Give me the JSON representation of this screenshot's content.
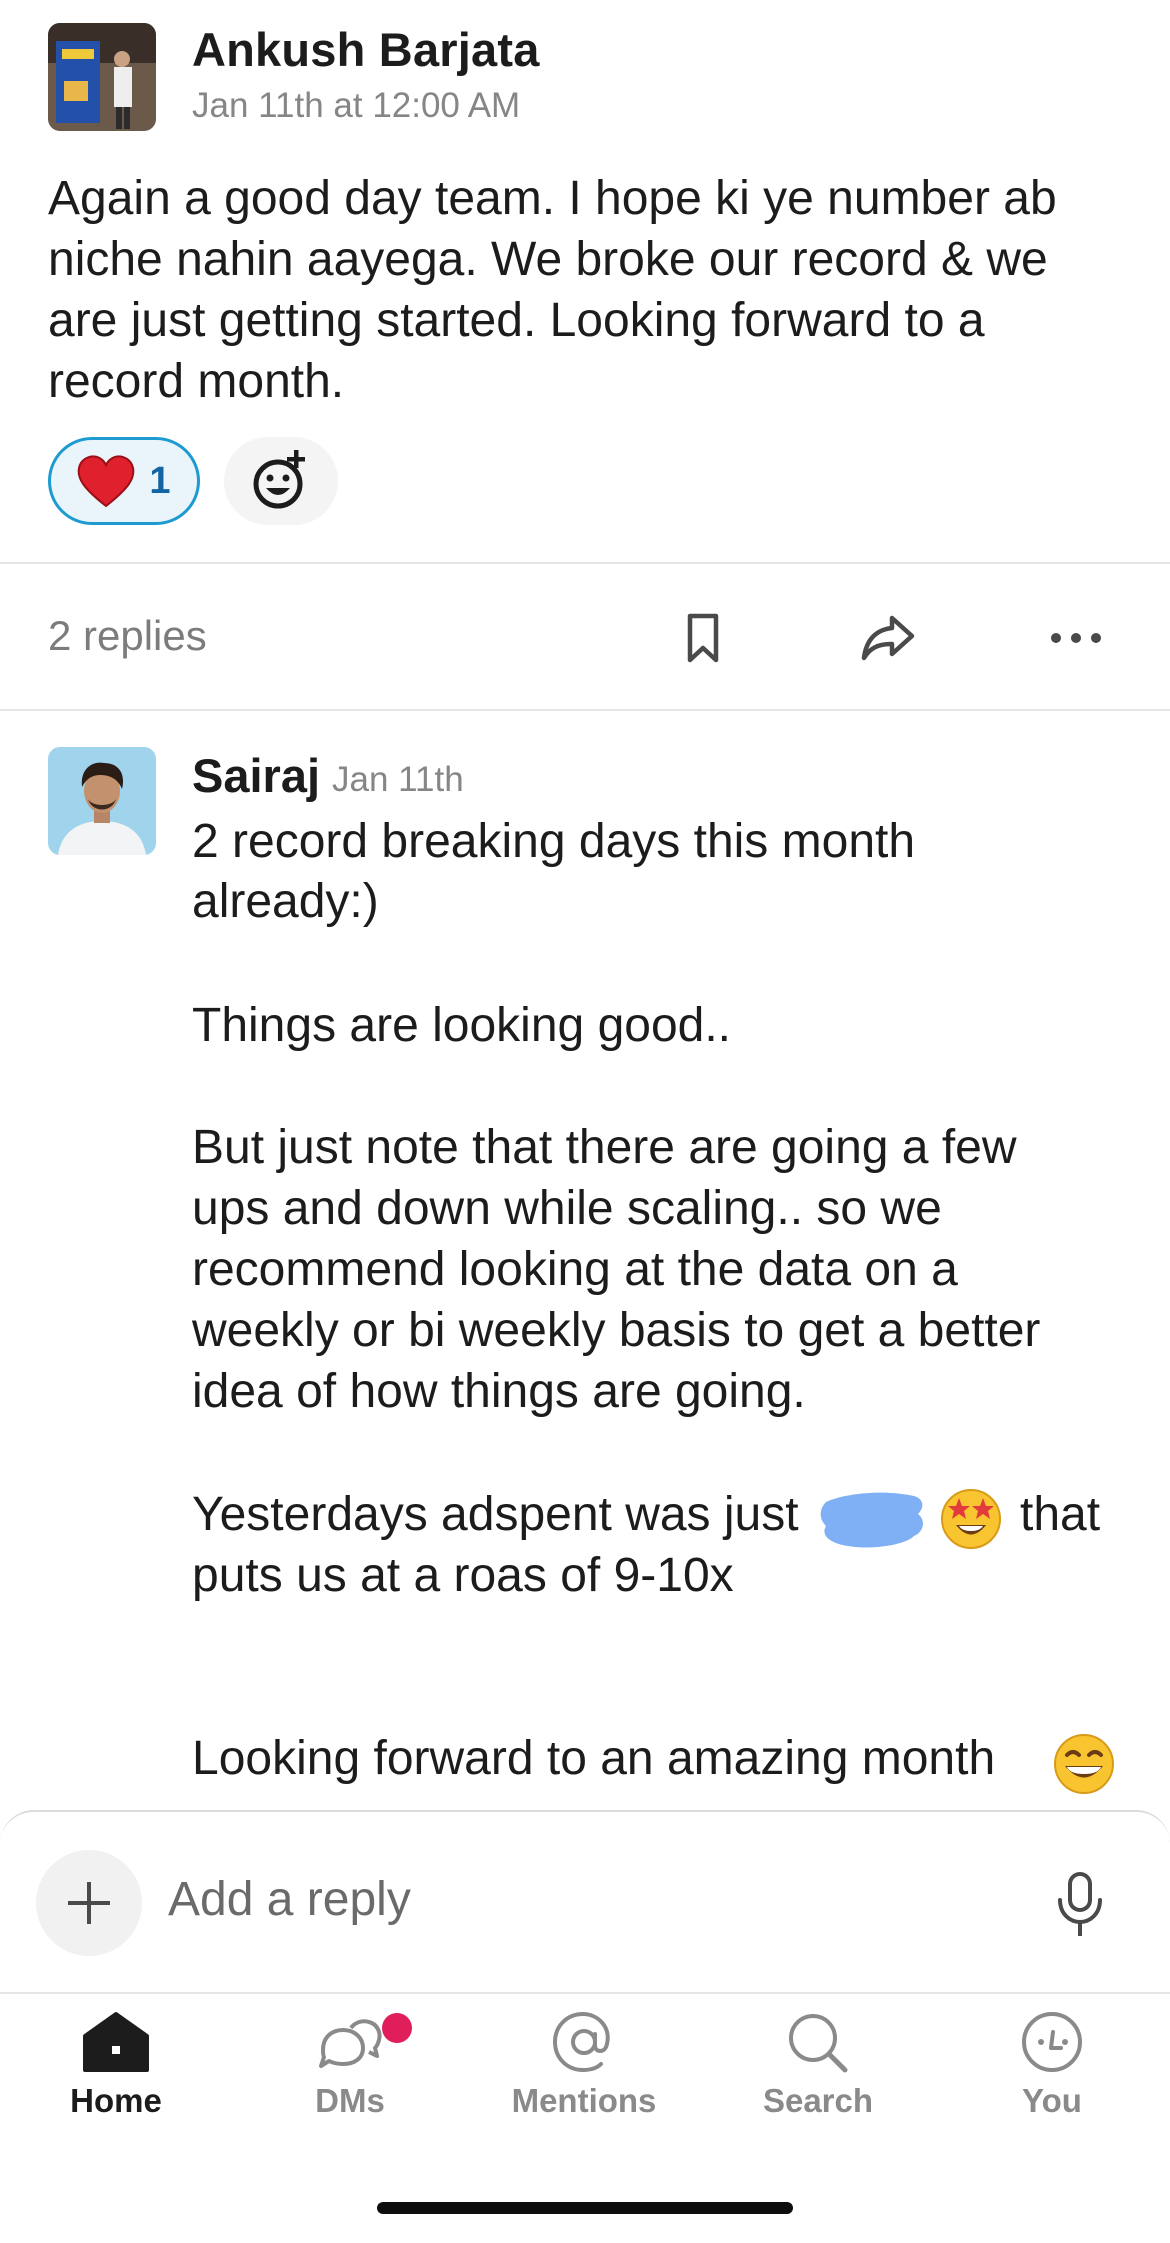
{
  "parent_message": {
    "author": "Ankush Barjata",
    "timestamp": "Jan 11th at 12:00 AM",
    "text": "Again a good day team. I hope ki ye number ab niche nahin aayega. We broke our record & we are just getting started. Looking forward to a record month.",
    "reactions": [
      {
        "emoji": "❤️",
        "count": "1",
        "icon": "red-heart-emoji"
      }
    ],
    "add_reaction_icon": "add-reaction-icon"
  },
  "thread_actions": {
    "replies_label": "2 replies",
    "icons": [
      "bookmark-icon",
      "share-icon",
      "more-options-icon"
    ]
  },
  "reply": {
    "author": "Sairaj",
    "timestamp": "Jan 11th",
    "lines": [
      "2 record breaking days this month",
      "already:)",
      "Things are looking good..",
      "But just note that there are going a few",
      "ups and down while scaling.. so we",
      "recommend looking at the data on a",
      "weekly or bi weekly basis to get a better",
      "idea of how things are going.",
      "Yesterdays adspent was just",
      "that",
      "puts us at a roas of 9-10x",
      "Looking forward to an amazing month"
    ],
    "redaction_color": "#7fb0f5",
    "emojis": [
      "star-struck-emoji",
      "grinning-face-emoji"
    ]
  },
  "composer": {
    "placeholder": "Add a reply",
    "plus_icon": "plus-icon",
    "mic_icon": "microphone-icon"
  },
  "tabbar": {
    "tabs": [
      {
        "label": "Home",
        "icon": "home-icon",
        "active": true
      },
      {
        "label": "DMs",
        "icon": "dms-icon",
        "active": false
      },
      {
        "label": "Mentions",
        "icon": "at-icon",
        "active": false
      },
      {
        "label": "Search",
        "icon": "search-icon",
        "active": false
      },
      {
        "label": "You",
        "icon": "you-icon",
        "active": false
      }
    ],
    "badge_color": "#e01e5a"
  },
  "colors": {
    "link_blue": "#1264a3",
    "reaction_border": "#1d9bd1",
    "text": "#1d1c1d",
    "muted": "#868686"
  }
}
